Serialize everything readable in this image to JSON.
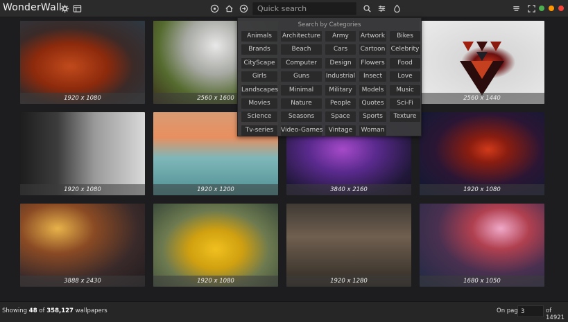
{
  "app": {
    "title": "WonderWall"
  },
  "toolbar": {
    "search_placeholder": "Quick search"
  },
  "window_buttons": [
    {
      "name": "minimize",
      "color": "#4caf50"
    },
    {
      "name": "maximize",
      "color": "#ff9800"
    },
    {
      "name": "close",
      "color": "#f44336"
    }
  ],
  "dropdown": {
    "title": "Search by Categories",
    "categories": [
      [
        "Animals",
        "Architecture",
        "Army",
        "Artwork",
        "Bikes"
      ],
      [
        "Brands",
        "Beach",
        "Cars",
        "Cartoon",
        "Celebrity"
      ],
      [
        "CityScape",
        "Computer",
        "Design",
        "Flowers",
        "Food"
      ],
      [
        "Girls",
        "Guns",
        "Industrial",
        "Insect",
        "Love"
      ],
      [
        "Landscapes",
        "Minimal",
        "Military",
        "Models",
        "Music"
      ],
      [
        "Movies",
        "Nature",
        "People",
        "Quotes",
        "Sci-Fi"
      ],
      [
        "Science",
        "Seasons",
        "Space",
        "Sports",
        "Texture"
      ],
      [
        "Tv-series",
        "Video-Games",
        "Vintage",
        "Woman"
      ]
    ]
  },
  "wallpapers": [
    {
      "res": "1920 x 1080",
      "theme": "leaf-icon"
    },
    {
      "res": "2560 x 1600",
      "theme": "moss-icon"
    },
    {
      "res": "",
      "theme": "hidden"
    },
    {
      "res": "2560 x 1440",
      "theme": "triangle-icon"
    },
    {
      "res": "1920 x 1080",
      "theme": "soldiers-icon"
    },
    {
      "res": "1920 x 1200",
      "theme": "sunset-icon"
    },
    {
      "res": "3840 x 2160",
      "theme": "crystal-icon"
    },
    {
      "res": "1920 x 1080",
      "theme": "nebula-icon"
    },
    {
      "res": "3888 x 2430",
      "theme": "lights-icon"
    },
    {
      "res": "1920 x 1080",
      "theme": "rope-icon"
    },
    {
      "res": "1920 x 1280",
      "theme": "bridge-icon"
    },
    {
      "res": "1680 x 1050",
      "theme": "fantasy-icon"
    }
  ],
  "status": {
    "prefix": "Showing",
    "shown": "48",
    "of": "of",
    "total": "358,127",
    "suffix": "wallpapers",
    "page_label": "On page",
    "page_value": "3",
    "page_total": "of 14921"
  }
}
